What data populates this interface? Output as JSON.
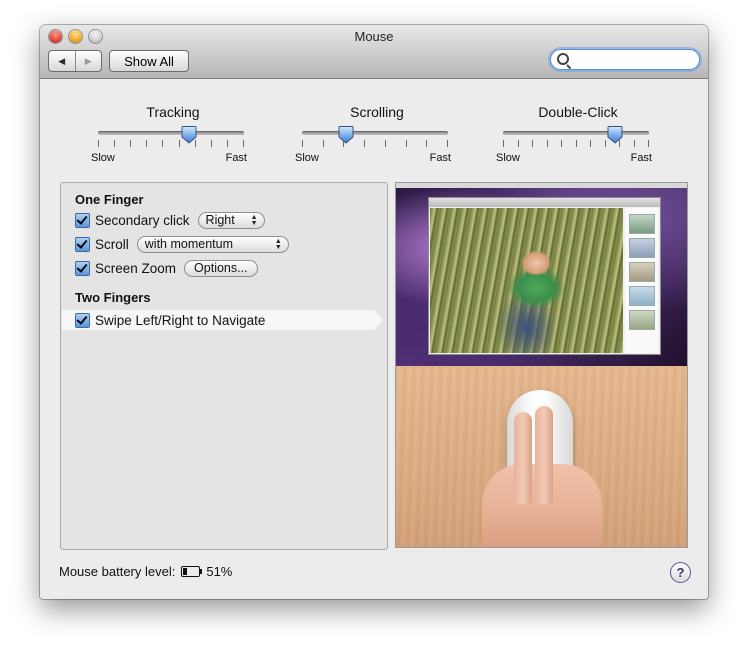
{
  "window": {
    "title": "Mouse"
  },
  "toolbar": {
    "back_icon": "◀",
    "forward_icon": "▶",
    "show_all_label": "Show All",
    "search_value": ""
  },
  "sliders": [
    {
      "title": "Tracking",
      "min_label": "Slow",
      "max_label": "Fast",
      "value": 0.62,
      "ticks": 10
    },
    {
      "title": "Scrolling",
      "min_label": "Slow",
      "max_label": "Fast",
      "value": 0.3,
      "ticks": 8
    },
    {
      "title": "Double-Click",
      "min_label": "Slow",
      "max_label": "Fast",
      "value": 0.77,
      "ticks": 11
    }
  ],
  "one_finger": {
    "heading": "One Finger",
    "secondary_click": {
      "label": "Secondary click",
      "checked": true,
      "value": "Right"
    },
    "scroll": {
      "label": "Scroll",
      "checked": true,
      "value": "with momentum"
    },
    "screen_zoom": {
      "label": "Screen Zoom",
      "checked": true,
      "button": "Options..."
    }
  },
  "two_fingers": {
    "heading": "Two Fingers",
    "swipe": {
      "label": "Swipe Left/Right to Navigate",
      "checked": true
    }
  },
  "footer": {
    "battery_label": "Mouse battery level:",
    "battery_value": "51%",
    "help_label": "?"
  }
}
